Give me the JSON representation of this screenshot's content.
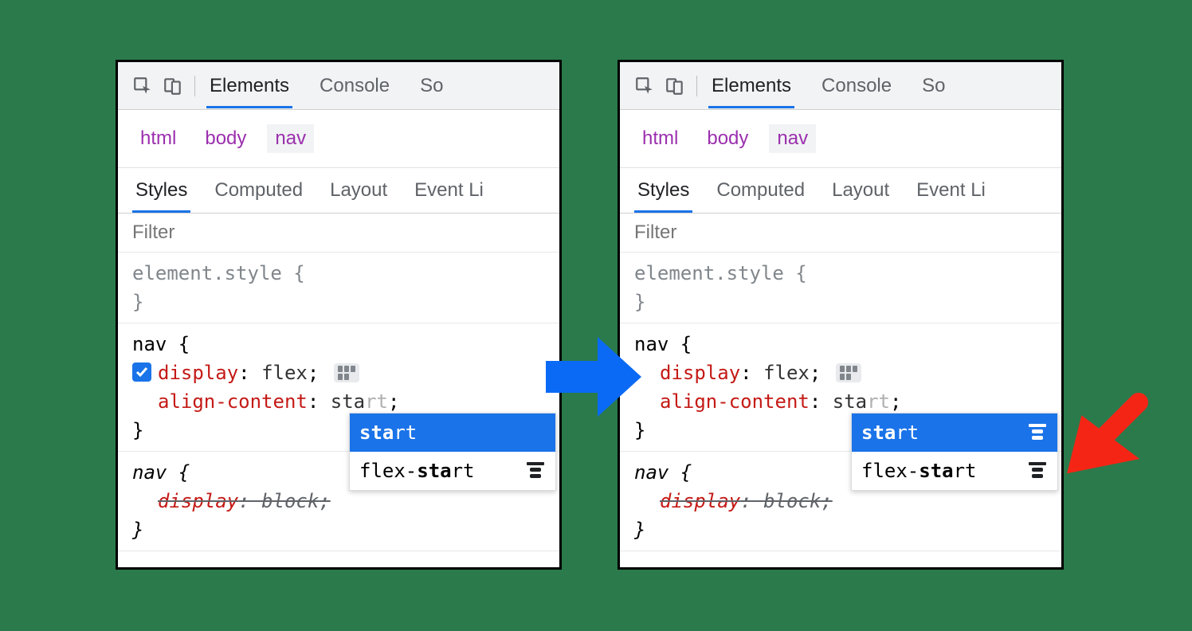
{
  "toolbar": {
    "tabs": [
      "Elements",
      "Console",
      "So"
    ],
    "active": "Elements"
  },
  "breadcrumb": [
    "html",
    "body",
    "nav"
  ],
  "subtabs": [
    "Styles",
    "Computed",
    "Layout",
    "Event Li"
  ],
  "filter_placeholder": "Filter",
  "styles": {
    "element_style_label": "element.style {",
    "close_brace": "}",
    "nav_open": "nav {",
    "display_prop": "display",
    "display_val": "flex",
    "align_prop": "align-content",
    "align_typed": "sta",
    "align_ghost": "rt",
    "semicolon": ";",
    "colon": ": ",
    "overridden_nav_open": "nav {",
    "overridden_display_prop": "display",
    "overridden_display_val": "block"
  },
  "dropdown": {
    "items": [
      {
        "bold": "sta",
        "rest": "rt",
        "value": "start",
        "selected": true
      },
      {
        "prefix": "flex-",
        "bold": "sta",
        "rest": "rt",
        "value": "flex-start",
        "selected": false
      }
    ]
  }
}
